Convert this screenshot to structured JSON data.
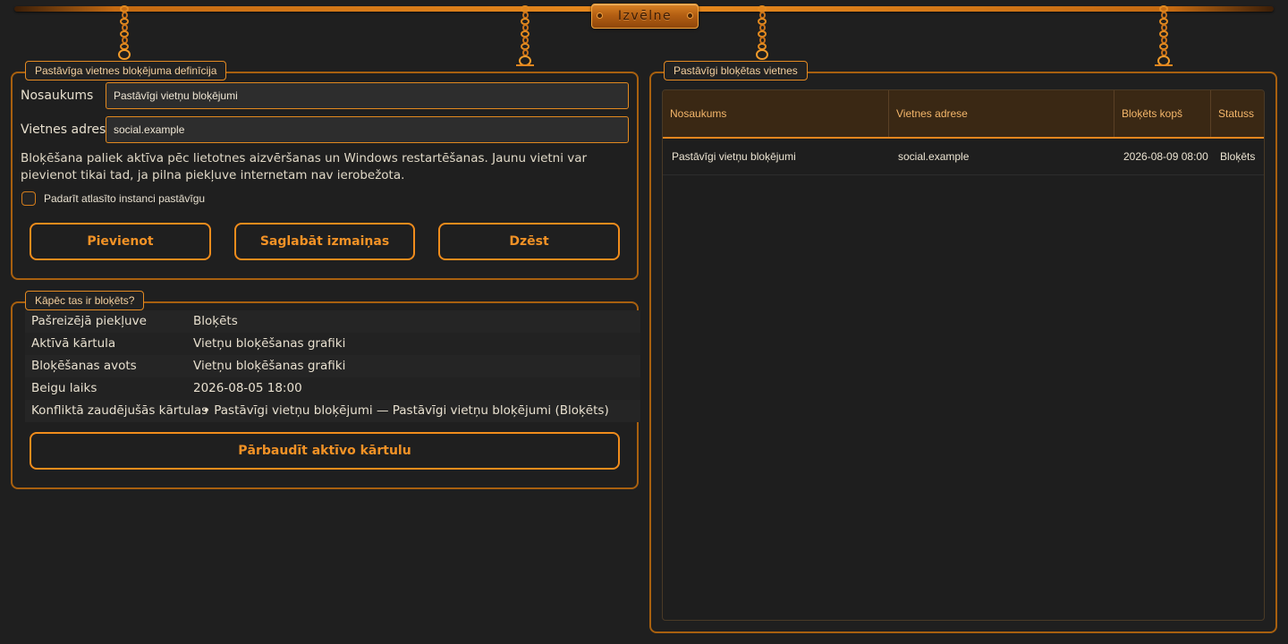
{
  "menu": {
    "label": "Izvēlne"
  },
  "definition": {
    "group_title": "Pastāvīga vietnes bloķējuma definīcija",
    "name_label": "Nosaukums",
    "name_value": "Pastāvīgi vietņu bloķējumi",
    "address_label": "Vietnes adrese",
    "address_value": "social.example",
    "description": "Bloķēšana paliek aktīva pēc lietotnes aizvēršanas un Windows restartēšanas. Jaunu vietni var pievienot tikai tad, ja pilna piekļuve internetam nav ierobežota.",
    "checkbox_label": "Padarīt atlasīto instanci pastāvīgu",
    "checkbox_checked": false,
    "buttons": {
      "add": "Pievienot",
      "save": "Saglabāt izmaiņas",
      "delete": "Dzēst"
    }
  },
  "why": {
    "group_title": "Kāpēc tas ir bloķēts?",
    "rows": [
      {
        "key": "Pašreizējā piekļuve",
        "value": "Bloķēts"
      },
      {
        "key": "Aktīvā kārtula",
        "value": "Vietņu bloķēšanas grafiki"
      },
      {
        "key": "Bloķēšanas avots",
        "value": "Vietņu bloķēšanas grafiki"
      },
      {
        "key": "Beigu laiks",
        "value": "2026-08-05 18:00"
      },
      {
        "key": "Konfliktā zaudējušās kārtulas",
        "value": "• Pastāvīgi vietņu bloķējumi — Pastāvīgi vietņu bloķējumi (Bloķēts)"
      }
    ],
    "check_button": "Pārbaudīt aktīvo kārtulu"
  },
  "blocked_sites": {
    "group_title": "Pastāvīgi bloķētas vietnes",
    "columns": [
      "Nosaukums",
      "Vietnes adrese",
      "Bloķēts kopš",
      "Statuss"
    ],
    "rows": [
      [
        "Pastāvīgi vietņu bloķējumi",
        "social.example",
        "2026-08-09 08:00",
        "Bloķēts"
      ]
    ]
  },
  "colors": {
    "background": "#1f1f1f",
    "accent": "#f08c1c",
    "border": "#a8600f",
    "header_text": "#f4b66a"
  }
}
